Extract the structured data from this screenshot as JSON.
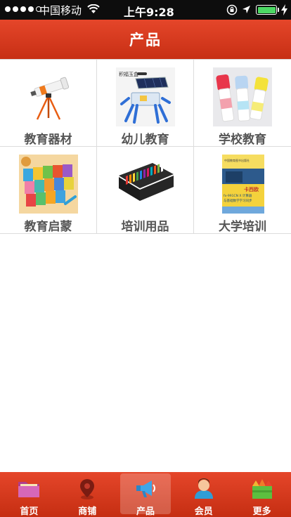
{
  "status_bar": {
    "carrier": "中国移动",
    "time": "上午9:28",
    "signal_bars": 4,
    "signal_total": 5,
    "battery_level": 1.0
  },
  "header": {
    "title": "产品"
  },
  "products": [
    {
      "label": "教育器材",
      "icon": "telescope-icon"
    },
    {
      "label": "幼儿教育",
      "icon": "solar-robot-kit-icon"
    },
    {
      "label": "学校教育",
      "icon": "paint-sticks-icon"
    },
    {
      "label": "教育启蒙",
      "icon": "picture-books-icon"
    },
    {
      "label": "培训用品",
      "icon": "pastel-set-icon"
    },
    {
      "label": "大学培训",
      "icon": "textbook-cover-icon"
    }
  ],
  "textbook_cover": {
    "publisher": "中国教育图书出版社",
    "title": "卡西欧",
    "subtitle": "fx-991CN X 计算器",
    "series": "与基础数学学习同步"
  },
  "kit_label": "积福玉盒",
  "tabbar": {
    "items": [
      {
        "label": "首页",
        "icon": "folder-icon",
        "active": false
      },
      {
        "label": "商铺",
        "icon": "map-pin-icon",
        "active": false
      },
      {
        "label": "产品",
        "icon": "megaphone-icon",
        "active": true
      },
      {
        "label": "会员",
        "icon": "user-icon",
        "active": false
      },
      {
        "label": "更多",
        "icon": "crown-icon",
        "active": false
      }
    ]
  },
  "colors": {
    "brand": "#d9391d",
    "label_text": "#555555",
    "divider": "#dcdcdc",
    "battery": "#4cd964"
  }
}
